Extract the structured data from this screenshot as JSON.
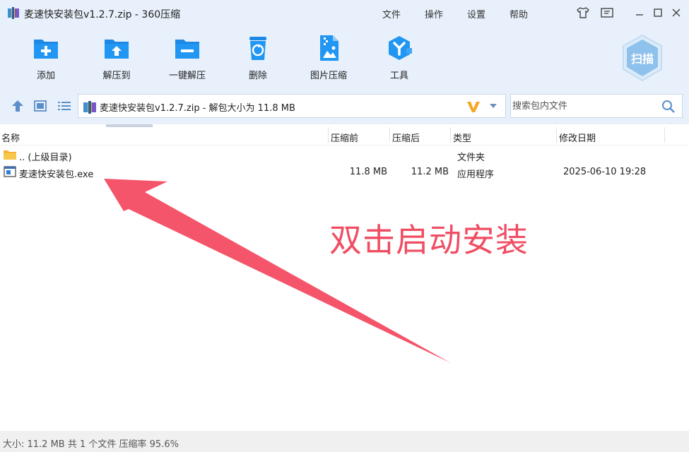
{
  "window": {
    "title": "麦速快安装包v1.2.7.zip - 360压缩",
    "menus": [
      "文件",
      "操作",
      "设置",
      "帮助"
    ]
  },
  "toolbar": {
    "items": [
      {
        "label": "添加",
        "icon": "add-icon"
      },
      {
        "label": "解压到",
        "icon": "extract-icon"
      },
      {
        "label": "一键解压",
        "icon": "one-click-extract-icon"
      },
      {
        "label": "删除",
        "icon": "delete-icon"
      },
      {
        "label": "图片压缩",
        "icon": "image-compress-icon"
      },
      {
        "label": "工具",
        "icon": "tools-icon"
      }
    ],
    "scan_label": "扫描"
  },
  "pathbar": {
    "path": "麦速快安装包v1.2.7.zip - 解包大小为 11.8 MB",
    "search_placeholder": "搜索包内文件"
  },
  "columns": [
    "名称",
    "压缩前",
    "压缩后",
    "类型",
    "修改日期"
  ],
  "rows": [
    {
      "name": ".. (上级目录)",
      "before": "",
      "after": "",
      "type": "文件夹",
      "date": "",
      "icon": "folder-icon"
    },
    {
      "name": "麦速快安装包.exe",
      "before": "11.8 MB",
      "after": "11.2 MB",
      "type": "应用程序",
      "date": "2025-06-10 19:28",
      "icon": "exe-icon"
    }
  ],
  "annotation": {
    "text": "双击启动安装",
    "color": "#f04e63"
  },
  "status": {
    "text": "大小: 11.2 MB 共 1 个文件 压缩率 95.6%"
  },
  "colors": {
    "toolbar_bg": "#e8f1fb",
    "icon_blue": "#1e88e5"
  }
}
